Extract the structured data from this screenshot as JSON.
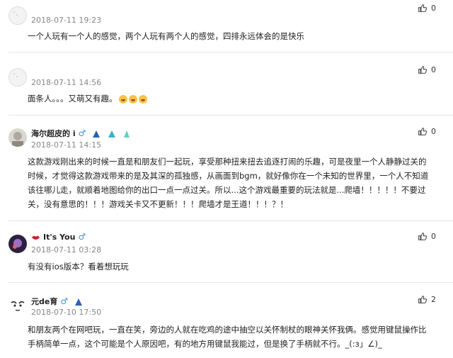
{
  "comments": [
    {
      "time": "2018-07-11 19:23",
      "likes": "0",
      "text": "一个人玩有一个人的感觉，两个人玩有两个人的感觉，四排永远体会的是快乐"
    },
    {
      "time": "2018-07-11 14:56",
      "likes": "0",
      "text": "面条人。。。又萌又有趣。"
    },
    {
      "username": "海尔超皮的 i",
      "time": "2018-07-11 14:15",
      "likes": "0",
      "lines": [
        "这款游戏刚出来的时候一直是和朋友们一起玩，享受那种扭来扭去追逐打闹的乐趣，可是夜里一个人静静过关的",
        "时候，才觉得这款游戏带来的是及其深的孤独感，从画面到bgm，就好像你在一个未知的世界里，一个人不知道",
        "该往哪儿走，就顺着地图给你的出口一点一点过关。所以...这个游戏最重要的玩法就是...爬墙！！！！！不要过",
        "关，没有意思的！！！游戏关卡又不更新！！！爬墙才是王道！！！？！"
      ]
    },
    {
      "username": "It's You",
      "time": "2018-07-11 03:28",
      "likes": "0",
      "text": "有没有ios版本？看着想玩玩"
    },
    {
      "username": "元de育",
      "time": "2018-07-10 17:50",
      "likes": "2",
      "lines": [
        "和朋友两个在网吧玩，一直在笑，旁边的人就在吃鸡的途中抽空以关怀制杖的眼神关怀我俩。感觉用键鼠操作比",
        "手柄简单一点，这个可能是个人原因吧，有的地方用键鼠我能过，但是换了手柄就不行。_(:з」∠)_"
      ]
    }
  ],
  "icons": {
    "like": "thumbs-up-icon",
    "gender": "male-icon"
  },
  "colors": {
    "male": "#3a8ee6",
    "time": "#888888",
    "divider": "#e6e6e6"
  }
}
